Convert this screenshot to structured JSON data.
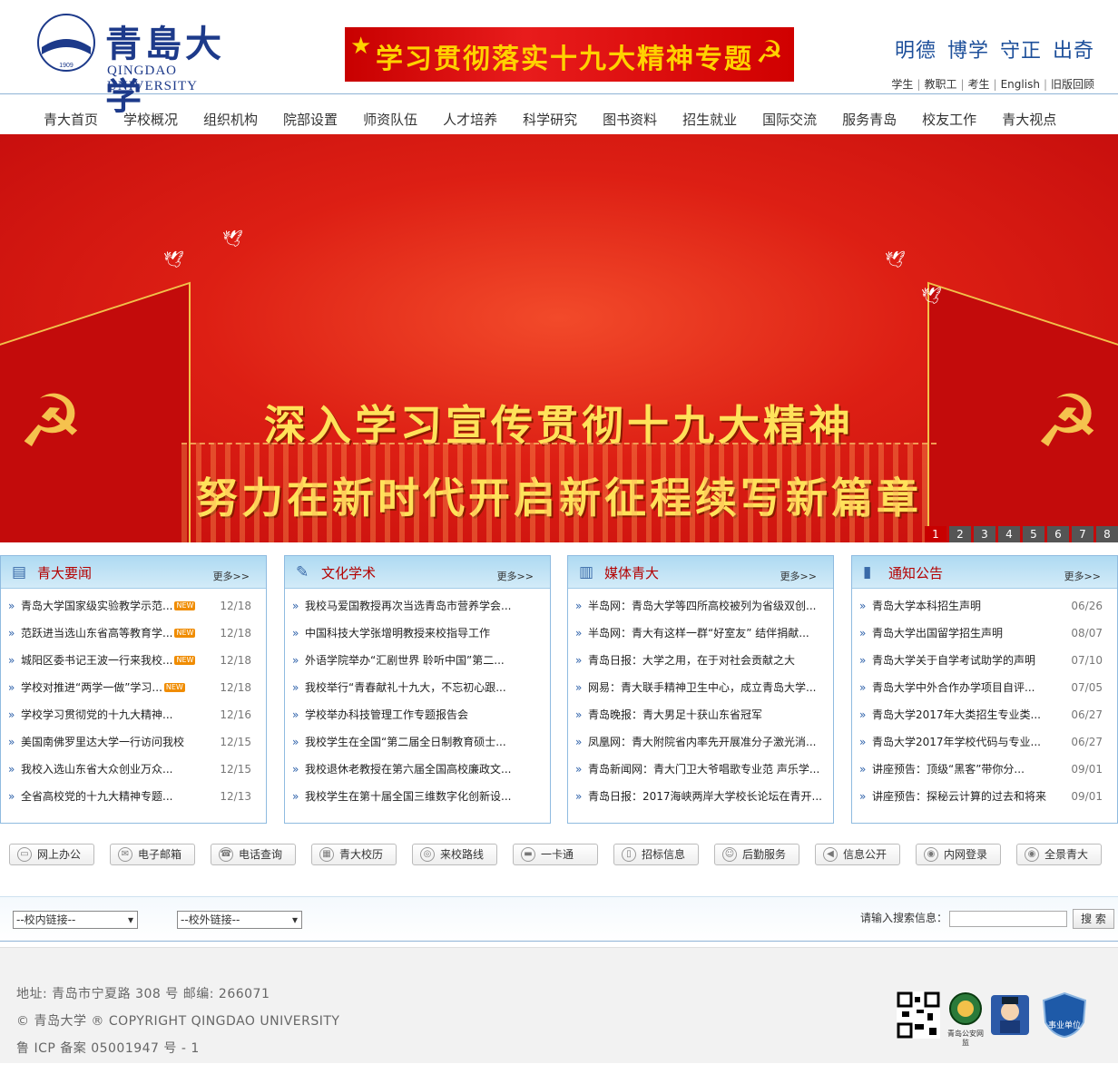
{
  "header": {
    "logo": {
      "cn": "青島大学",
      "en": "QINGDAO UNIVERSITY",
      "emblem_text": "QINGDAO UNIVERSITY",
      "year": "1909"
    },
    "topic_banner": "学习贯彻落实十九大精神专题",
    "motto": [
      "明德",
      "博学",
      "守正",
      "出奇"
    ],
    "links": [
      "学生",
      "教职工",
      "考生",
      "English",
      "旧版回顾"
    ]
  },
  "nav": [
    "青大首页",
    "学校概况",
    "组织机构",
    "院部设置",
    "师资队伍",
    "人才培养",
    "科学研究",
    "图书资料",
    "招生就业",
    "国际交流",
    "服务青岛",
    "校友工作",
    "青大视点"
  ],
  "slider": {
    "line1": "深入学习宣传贯彻十九大精神",
    "line2": "努力在新时代开启新征程续写新篇章",
    "pages": [
      "1",
      "2",
      "3",
      "4",
      "5",
      "6",
      "7",
      "8"
    ],
    "active_page": "1"
  },
  "boxes": [
    {
      "title": "青大要闻",
      "more": "更多>>",
      "items": [
        {
          "t": "青岛大学国家级实验教学示范...",
          "d": "12/18",
          "new": "NEW"
        },
        {
          "t": "范跃进当选山东省高等教育学...",
          "d": "12/18",
          "new": "NEW"
        },
        {
          "t": "城阳区委书记王波一行来我校...",
          "d": "12/18",
          "new": "NEW"
        },
        {
          "t": "学校对推进“两学一做”学习...",
          "d": "12/18",
          "new": "NEW"
        },
        {
          "t": "学校学习贯彻党的十九大精神...",
          "d": "12/16"
        },
        {
          "t": "美国南佛罗里达大学一行访问我校",
          "d": "12/15"
        },
        {
          "t": "我校入选山东省大众创业万众...",
          "d": "12/15"
        },
        {
          "t": "全省高校党的十九大精神专题...",
          "d": "12/13"
        }
      ]
    },
    {
      "title": "文化学术",
      "more": "更多>>",
      "items": [
        {
          "t": "我校马爱国教授再次当选青岛市营养学会..."
        },
        {
          "t": "中国科技大学张增明教授来校指导工作"
        },
        {
          "t": "外语学院举办“汇剧世界 聆听中国”第二..."
        },
        {
          "t": "我校举行“青春献礼十九大，不忘初心跟..."
        },
        {
          "t": "学校举办科技管理工作专题报告会"
        },
        {
          "t": "我校学生在全国“第二届全日制教育硕士..."
        },
        {
          "t": "我校退休老教授在第六届全国高校廉政文..."
        },
        {
          "t": "我校学生在第十届全国三维数字化创新设..."
        }
      ]
    },
    {
      "title": "媒体青大",
      "more": "更多>>",
      "items": [
        {
          "t": "半岛网：青岛大学等四所高校被列为省级双创..."
        },
        {
          "t": "半岛网：青大有这样一群“好室友” 结伴捐献..."
        },
        {
          "t": "青岛日报：大学之用，在于对社会贡献之大"
        },
        {
          "t": "网易：青大联手精神卫生中心，成立青岛大学..."
        },
        {
          "t": "青岛晚报：青大男足十获山东省冠军"
        },
        {
          "t": "凤凰网：青大附院省内率先开展准分子激光消..."
        },
        {
          "t": "青岛新闻网：青大门卫大爷唱歌专业范 声乐学..."
        },
        {
          "t": "青岛日报：2017海峡两岸大学校长论坛在青开..."
        }
      ]
    },
    {
      "title": "通知公告",
      "more": "更多>>",
      "items": [
        {
          "t": "青岛大学本科招生声明",
          "d": "06/26"
        },
        {
          "t": "青岛大学出国留学招生声明",
          "d": "08/07"
        },
        {
          "t": "青岛大学关于自学考试助学的声明",
          "d": "07/10"
        },
        {
          "t": "青岛大学中外合作办学项目自评...",
          "d": "07/05"
        },
        {
          "t": "青岛大学2017年大类招生专业类...",
          "d": "06/27"
        },
        {
          "t": "青岛大学2017年学校代码与专业...",
          "d": "06/27"
        },
        {
          "t": "讲座预告：顶级“黑客”带你分...",
          "d": "09/01"
        },
        {
          "t": "讲座预告：探秘云计算的过去和将来",
          "d": "09/01"
        }
      ]
    }
  ],
  "quick_links": [
    "网上办公",
    "电子邮箱",
    "电话查询",
    "青大校历",
    "来校路线",
    "一卡通",
    "招标信息",
    "后勤服务",
    "信息公开",
    "内网登录",
    "全景青大"
  ],
  "search": {
    "internal_links": "--校内链接--",
    "external_links": "--校外链接--",
    "label": "请输入搜索信息：",
    "button": "搜 索"
  },
  "footer": {
    "address": "地址: 青岛市宁夏路 308 号 邮编: 266071",
    "copyright": "© 青岛大学 ® COPYRIGHT QINGDAO UNIVERSITY",
    "icp": "鲁 ICP 备案 05001947 号 - 1",
    "badges": {
      "police": "青岛公安网监",
      "unit": "事业单位"
    }
  },
  "colors": {
    "brand": "#1d3a8a",
    "accent_red": "#c80000",
    "box_header": "#aedaf2"
  }
}
